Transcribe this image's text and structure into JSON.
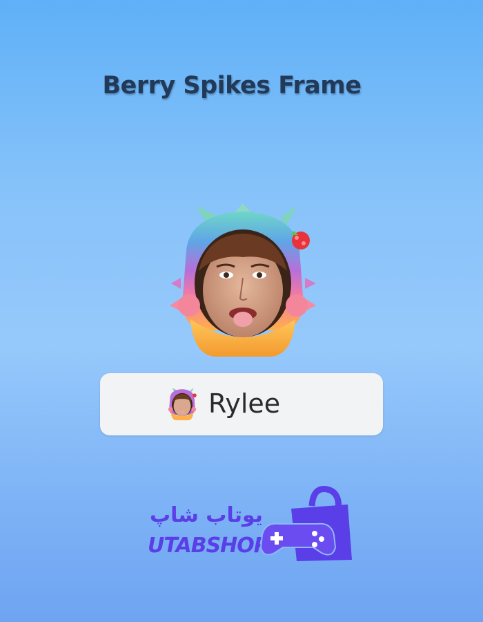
{
  "title": "Berry Spikes Frame",
  "profile": {
    "name": "Rylee"
  },
  "brand": {
    "name_fa": "یوتاب شاپ",
    "name_en": "UTABSHOP"
  },
  "colors": {
    "title": "#223a58",
    "brand": "#5a3ee8",
    "pill": "#f1f3f5"
  },
  "icons": {
    "frame": "berry-spikes-frame-icon",
    "mini_frame": "avatar-frame-icon",
    "bag": "shopping-bag-gamepad-icon"
  }
}
